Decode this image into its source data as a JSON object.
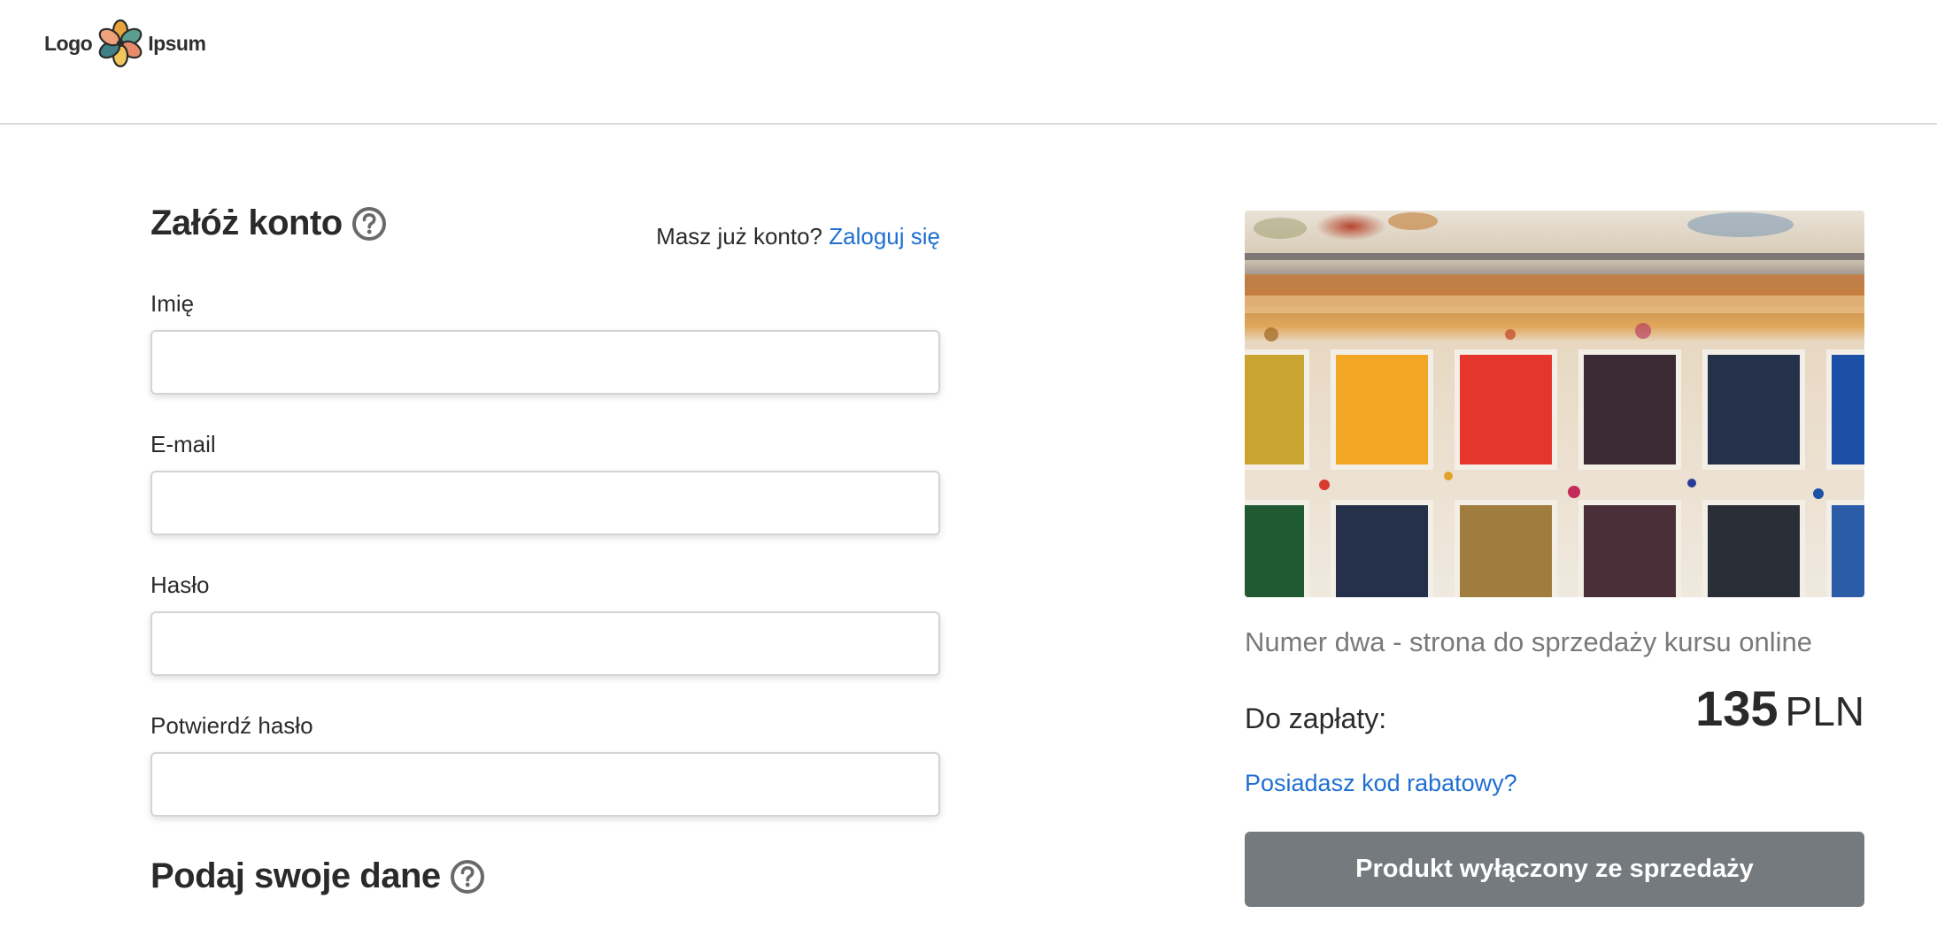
{
  "header": {
    "logo_left": "Logo",
    "logo_right": "Ipsum"
  },
  "signup": {
    "title": "Załóż konto",
    "login_prompt": "Masz już konto?",
    "login_link": "Zaloguj się",
    "fields": [
      {
        "label": "Imię",
        "value": "",
        "placeholder": ""
      },
      {
        "label": "E-mail",
        "value": "",
        "placeholder": ""
      },
      {
        "label": "Hasło",
        "value": "",
        "placeholder": ""
      },
      {
        "label": "Potwierdź hasło",
        "value": "",
        "placeholder": ""
      }
    ]
  },
  "details": {
    "title": "Podaj swoje dane"
  },
  "product": {
    "image_label": "watercolor-paint-palette",
    "name": "Numer dwa - strona do sprzedaży kursu online",
    "pay_label": "Do zapłaty:",
    "price_amount": "135",
    "price_currency": "PLN",
    "discount_link": "Posiadasz kod rabatowy?",
    "button_label": "Produkt wyłączony ze sprzedaży"
  },
  "colors": {
    "link": "#1f6fd1",
    "button_disabled": "#757a7e",
    "divider": "#dcdcdc"
  }
}
